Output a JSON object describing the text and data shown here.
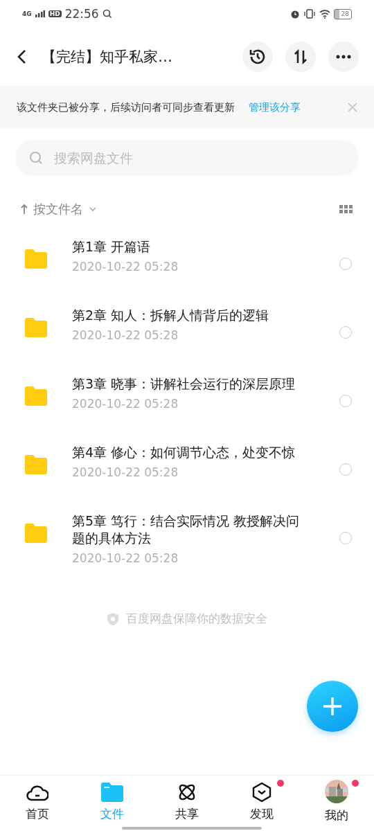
{
  "status_bar": {
    "network": "4G",
    "hd": "HD",
    "time": "22:56",
    "battery": "28"
  },
  "header": {
    "title": "【完结】知乎私家…"
  },
  "share_banner": {
    "text": "该文件夹已被分享，后续访问者可同步查看更新",
    "link": "管理该分享"
  },
  "search": {
    "placeholder": "搜索网盘文件"
  },
  "sort": {
    "label": "按文件名"
  },
  "files": [
    {
      "name": "第1章 开篇语",
      "date": "2020-10-22  05:28",
      "selected": false
    },
    {
      "name": "第2章 知人：拆解人情背后的逻辑",
      "date": "2020-10-22  05:28",
      "selected": false
    },
    {
      "name": "第3章 晓事：讲解社会运行的深层原理",
      "date": "2020-10-22  05:28",
      "selected": false
    },
    {
      "name": "第4章 修心：如何调节心态，处变不惊",
      "date": "2020-10-22  05:28",
      "selected": false
    },
    {
      "name": "第5章 笃行：结合实际情况 教授解决问题的具体方法",
      "date": "2020-10-22  05:28",
      "selected": false
    }
  ],
  "notice": "百度网盘保障你的数据安全",
  "tabs": [
    {
      "kind": "cloud",
      "label": "首页",
      "selected": false,
      "badge": false
    },
    {
      "kind": "folder",
      "label": "文件",
      "selected": true,
      "badge": false
    },
    {
      "kind": "atom",
      "label": "共享",
      "selected": false,
      "badge": false
    },
    {
      "kind": "hexagon",
      "label": "发现",
      "selected": false,
      "badge": true
    },
    {
      "kind": "avatar",
      "label": "我的",
      "selected": false,
      "badge": true
    }
  ]
}
